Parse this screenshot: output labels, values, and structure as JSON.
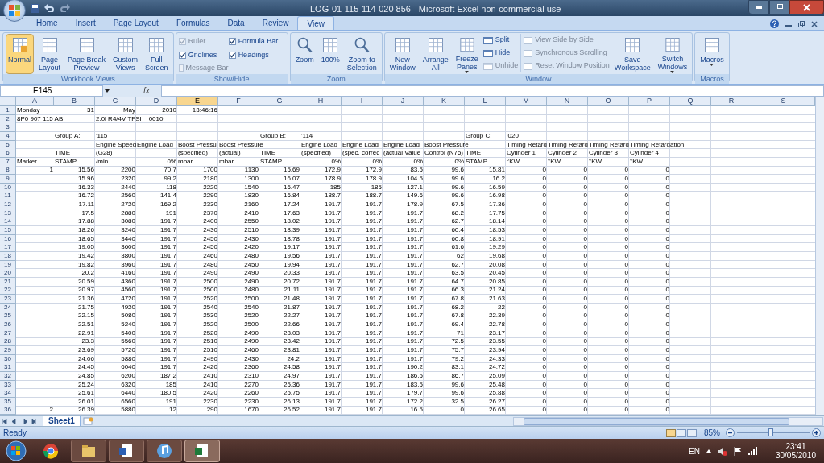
{
  "window": {
    "title": "LOG-01-115-114-020 856 - Microsoft Excel non-commercial use"
  },
  "tabs": [
    {
      "label": "Home",
      "selected": false
    },
    {
      "label": "Insert",
      "selected": false
    },
    {
      "label": "Page Layout",
      "selected": false
    },
    {
      "label": "Formulas",
      "selected": false
    },
    {
      "label": "Data",
      "selected": false
    },
    {
      "label": "Review",
      "selected": false
    },
    {
      "label": "View",
      "selected": true
    }
  ],
  "ribbon": {
    "workbook_views": {
      "title": "Workbook Views",
      "buttons": [
        {
          "label": "Normal",
          "selected": true
        },
        {
          "label": "Page\nLayout",
          "selected": false
        },
        {
          "label": "Page Break\nPreview",
          "selected": false
        },
        {
          "label": "Custom\nViews",
          "selected": false
        },
        {
          "label": "Full\nScreen",
          "selected": false
        }
      ]
    },
    "show_hide": {
      "title": "Show/Hide",
      "checkboxes": [
        {
          "label": "Ruler",
          "checked": true,
          "disabled": true
        },
        {
          "label": "Formula Bar",
          "checked": true,
          "disabled": false
        },
        {
          "label": "Gridlines",
          "checked": true,
          "disabled": false
        },
        {
          "label": "Headings",
          "checked": true,
          "disabled": false
        },
        {
          "label": "Message Bar",
          "checked": false,
          "disabled": true
        }
      ]
    },
    "zoom": {
      "title": "Zoom",
      "buttons": [
        {
          "label": "Zoom",
          "kind": "magnifier"
        },
        {
          "label": "100%",
          "kind": "page"
        },
        {
          "label": "Zoom to\nSelection",
          "kind": "magnifier"
        }
      ]
    },
    "window": {
      "title": "Window",
      "large": [
        {
          "label": "New\nWindow",
          "dropdown": false
        },
        {
          "label": "Arrange\nAll",
          "dropdown": false
        },
        {
          "label": "Freeze\nPanes",
          "dropdown": true
        }
      ],
      "small": [
        {
          "label": "Split",
          "disabled": false
        },
        {
          "label": "Hide",
          "disabled": false
        },
        {
          "label": "Unhide",
          "disabled": true
        },
        {
          "label": "View Side by Side",
          "disabled": true
        },
        {
          "label": "Synchronous Scrolling",
          "disabled": true
        },
        {
          "label": "Reset Window Position",
          "disabled": true
        }
      ],
      "large_right": [
        {
          "label": "Save\nWorkspace",
          "dropdown": false
        },
        {
          "label": "Switch\nWindows",
          "dropdown": true
        }
      ]
    },
    "macros": {
      "title": "Macros",
      "button": {
        "label": "Macros",
        "dropdown": true
      }
    }
  },
  "formula_bar": {
    "name_box": "E145",
    "fx": "fx"
  },
  "sheet": {
    "columns": [
      {
        "label": "A",
        "selected": false
      },
      {
        "label": "B",
        "selected": false
      },
      {
        "label": "C",
        "selected": false
      },
      {
        "label": "D",
        "selected": false
      },
      {
        "label": "E",
        "selected": true
      },
      {
        "label": "F",
        "selected": false
      },
      {
        "label": "G",
        "selected": false
      },
      {
        "label": "H",
        "selected": false
      },
      {
        "label": "I",
        "selected": false
      },
      {
        "label": "J",
        "selected": false
      },
      {
        "label": "K",
        "selected": false
      },
      {
        "label": "L",
        "selected": false
      },
      {
        "label": "M",
        "selected": false
      },
      {
        "label": "N",
        "selected": false
      },
      {
        "label": "O",
        "selected": false
      },
      {
        "label": "P",
        "selected": false
      },
      {
        "label": "Q",
        "selected": false
      },
      {
        "label": "R",
        "selected": false
      },
      {
        "label": "S",
        "selected": false
      }
    ],
    "rows": [
      {
        "label": "1",
        "kind": "header",
        "cells": {
          "A": {
            "text": "Monday",
            "kind": "text"
          },
          "B": {
            "text": "31",
            "kind": "number"
          },
          "C": {
            "text": "May",
            "kind": "number"
          },
          "D": {
            "text": "2010",
            "kind": "number"
          },
          "E": {
            "text": "13:46:16",
            "kind": "number"
          }
        }
      },
      {
        "label": "2",
        "kind": "header",
        "cells": {
          "A": {
            "text": "8P0 907 115 AB",
            "kind": "text"
          },
          "C": {
            "text": "2.0l R4/4V TFSI    0010",
            "kind": "text"
          }
        }
      },
      {
        "label": "3",
        "kind": "header"
      },
      {
        "label": "4",
        "kind": "header",
        "cells": {
          "B": {
            "text": "Group A:",
            "kind": "text"
          },
          "C": {
            "text": "'115",
            "kind": "text"
          },
          "G": {
            "text": "Group B:",
            "kind": "text"
          },
          "H": {
            "text": "'114",
            "kind": "text"
          },
          "L": {
            "text": "Group C:",
            "kind": "text"
          },
          "M": {
            "text": "'020",
            "kind": "text"
          }
        }
      },
      {
        "label": "5",
        "kind": "header",
        "cells": {
          "C": {
            "text": "Engine Speed",
            "kind": "text"
          },
          "D": {
            "text": "Engine Load",
            "kind": "text"
          },
          "E": {
            "text": "Boost Pressu",
            "kind": "text"
          },
          "F": {
            "text": "Boost Pressure",
            "kind": "text"
          },
          "H": {
            "text": "Engine Load",
            "kind": "text"
          },
          "I": {
            "text": "Engine Load",
            "kind": "text"
          },
          "J": {
            "text": "Engine Load",
            "kind": "text"
          },
          "K": {
            "text": "Boost Pressure",
            "kind": "text"
          },
          "M": {
            "text": "Timing Retard",
            "kind": "text"
          },
          "N": {
            "text": "Timing Retard",
            "kind": "text"
          },
          "O": {
            "text": "Timing Retard",
            "kind": "text"
          },
          "P": {
            "text": "Timing Retardation",
            "kind": "text"
          }
        }
      },
      {
        "label": "6",
        "kind": "header",
        "cells": {
          "B": {
            "text": "TIME",
            "kind": "text"
          },
          "C": {
            "text": "(G28)",
            "kind": "text"
          },
          "E": {
            "text": "(specified)",
            "kind": "text"
          },
          "F": {
            "text": "(actual)",
            "kind": "text"
          },
          "G": {
            "text": "TIME",
            "kind": "text"
          },
          "H": {
            "text": "(specified)",
            "kind": "text"
          },
          "I": {
            "text": "(spec. correc",
            "kind": "text"
          },
          "J": {
            "text": "(actual Value",
            "kind": "text"
          },
          "K": {
            "text": "Control (N75)",
            "kind": "text"
          },
          "L": {
            "text": "TIME",
            "kind": "text"
          },
          "M": {
            "text": "Cylinder 1",
            "kind": "text"
          },
          "N": {
            "text": "Cylinder 2",
            "kind": "text"
          },
          "O": {
            "text": "Cylinder 3",
            "kind": "text"
          },
          "P": {
            "text": "Cylinder 4",
            "kind": "text"
          }
        }
      },
      {
        "label": "7",
        "kind": "header",
        "cells": {
          "A": {
            "text": "Marker",
            "kind": "text"
          },
          "B": {
            "text": "STAMP",
            "kind": "text"
          },
          "C": {
            "text": "/min",
            "kind": "text"
          },
          "D": {
            "text": "0%",
            "kind": "number"
          },
          "E": {
            "text": "mbar",
            "kind": "text"
          },
          "F": {
            "text": "mbar",
            "kind": "text"
          },
          "G": {
            "text": "STAMP",
            "kind": "text"
          },
          "H": {
            "text": "0%",
            "kind": "number"
          },
          "I": {
            "text": "0%",
            "kind": "number"
          },
          "J": {
            "text": "0%",
            "kind": "number"
          },
          "K": {
            "text": "0%",
            "kind": "number"
          },
          "L": {
            "text": "STAMP",
            "kind": "text"
          },
          "M": {
            "text": "°KW",
            "kind": "text"
          },
          "N": {
            "text": "°KW",
            "kind": "text"
          },
          "O": {
            "text": "°KW",
            "kind": "text"
          },
          "P": {
            "text": "°KW",
            "kind": "text"
          }
        }
      },
      {
        "label": "8",
        "kind": "data",
        "marker": "1",
        "values": [
          "15.56",
          "2200",
          "70.7",
          "1700",
          "1130",
          "15.69",
          "172.9",
          "172.9",
          "83.5",
          "99.6",
          "15.81",
          "0",
          "0",
          "0",
          "0"
        ]
      },
      {
        "label": "9",
        "kind": "data",
        "values": [
          "15.96",
          "2320",
          "99.2",
          "2180",
          "1300",
          "16.07",
          "178.9",
          "178.9",
          "104.5",
          "99.6",
          "16.2",
          "0",
          "0",
          "0",
          "0"
        ]
      },
      {
        "label": "10",
        "kind": "data",
        "values": [
          "16.33",
          "2440",
          "118",
          "2220",
          "1540",
          "16.47",
          "185",
          "185",
          "127.1",
          "99.6",
          "16.59",
          "0",
          "0",
          "0",
          "0"
        ]
      },
      {
        "label": "11",
        "kind": "data",
        "values": [
          "16.72",
          "2560",
          "141.4",
          "2290",
          "1830",
          "16.84",
          "188.7",
          "188.7",
          "149.6",
          "99.6",
          "16.98",
          "0",
          "0",
          "0",
          "0"
        ]
      },
      {
        "label": "12",
        "kind": "data",
        "values": [
          "17.11",
          "2720",
          "169.2",
          "2330",
          "2160",
          "17.24",
          "191.7",
          "191.7",
          "178.9",
          "67.5",
          "17.36",
          "0",
          "0",
          "0",
          "0"
        ]
      },
      {
        "label": "13",
        "kind": "data",
        "values": [
          "17.5",
          "2880",
          "191",
          "2370",
          "2410",
          "17.63",
          "191.7",
          "191.7",
          "191.7",
          "68.2",
          "17.75",
          "0",
          "0",
          "0",
          "0"
        ]
      },
      {
        "label": "14",
        "kind": "data",
        "values": [
          "17.88",
          "3080",
          "191.7",
          "2400",
          "2550",
          "18.02",
          "191.7",
          "191.7",
          "191.7",
          "62.7",
          "18.14",
          "0",
          "0",
          "0",
          "0"
        ]
      },
      {
        "label": "15",
        "kind": "data",
        "values": [
          "18.26",
          "3240",
          "191.7",
          "2430",
          "2510",
          "18.39",
          "191.7",
          "191.7",
          "191.7",
          "60.4",
          "18.53",
          "0",
          "0",
          "0",
          "0"
        ]
      },
      {
        "label": "16",
        "kind": "data",
        "values": [
          "18.65",
          "3440",
          "191.7",
          "2450",
          "2430",
          "18.78",
          "191.7",
          "191.7",
          "191.7",
          "60.8",
          "18.91",
          "0",
          "0",
          "0",
          "0"
        ]
      },
      {
        "label": "17",
        "kind": "data",
        "values": [
          "19.05",
          "3600",
          "191.7",
          "2450",
          "2420",
          "19.17",
          "191.7",
          "191.7",
          "191.7",
          "61.6",
          "19.29",
          "0",
          "0",
          "0",
          "0"
        ]
      },
      {
        "label": "18",
        "kind": "data",
        "values": [
          "19.42",
          "3800",
          "191.7",
          "2460",
          "2480",
          "19.56",
          "191.7",
          "191.7",
          "191.7",
          "62",
          "19.68",
          "0",
          "0",
          "0",
          "0"
        ]
      },
      {
        "label": "19",
        "kind": "data",
        "values": [
          "19.82",
          "3960",
          "191.7",
          "2480",
          "2450",
          "19.94",
          "191.7",
          "191.7",
          "191.7",
          "62.7",
          "20.08",
          "0",
          "0",
          "0",
          "0"
        ]
      },
      {
        "label": "20",
        "kind": "data",
        "values": [
          "20.2",
          "4160",
          "191.7",
          "2490",
          "2490",
          "20.33",
          "191.7",
          "191.7",
          "191.7",
          "63.5",
          "20.45",
          "0",
          "0",
          "0",
          "0"
        ]
      },
      {
        "label": "21",
        "kind": "data",
        "values": [
          "20.59",
          "4360",
          "191.7",
          "2500",
          "2490",
          "20.72",
          "191.7",
          "191.7",
          "191.7",
          "64.7",
          "20.85",
          "0",
          "0",
          "0",
          "0"
        ]
      },
      {
        "label": "22",
        "kind": "data",
        "values": [
          "20.97",
          "4560",
          "191.7",
          "2500",
          "2480",
          "21.11",
          "191.7",
          "191.7",
          "191.7",
          "66.3",
          "21.24",
          "0",
          "0",
          "0",
          "0"
        ]
      },
      {
        "label": "23",
        "kind": "data",
        "values": [
          "21.36",
          "4720",
          "191.7",
          "2520",
          "2500",
          "21.48",
          "191.7",
          "191.7",
          "191.7",
          "67.8",
          "21.63",
          "0",
          "0",
          "0",
          "0"
        ]
      },
      {
        "label": "24",
        "kind": "data",
        "values": [
          "21.75",
          "4920",
          "191.7",
          "2540",
          "2540",
          "21.87",
          "191.7",
          "191.7",
          "191.7",
          "68.2",
          "22",
          "0",
          "0",
          "0",
          "0"
        ]
      },
      {
        "label": "25",
        "kind": "data",
        "values": [
          "22.15",
          "5080",
          "191.7",
          "2530",
          "2520",
          "22.27",
          "191.7",
          "191.7",
          "191.7",
          "67.8",
          "22.39",
          "0",
          "0",
          "0",
          "0"
        ]
      },
      {
        "label": "26",
        "kind": "data",
        "values": [
          "22.51",
          "5240",
          "191.7",
          "2520",
          "2500",
          "22.66",
          "191.7",
          "191.7",
          "191.7",
          "69.4",
          "22.78",
          "0",
          "0",
          "0",
          "0"
        ]
      },
      {
        "label": "27",
        "kind": "data",
        "values": [
          "22.91",
          "5400",
          "191.7",
          "2520",
          "2490",
          "23.03",
          "191.7",
          "191.7",
          "191.7",
          "71",
          "23.17",
          "0",
          "0",
          "0",
          "0"
        ]
      },
      {
        "label": "28",
        "kind": "data",
        "values": [
          "23.3",
          "5560",
          "191.7",
          "2510",
          "2490",
          "23.42",
          "191.7",
          "191.7",
          "191.7",
          "72.5",
          "23.55",
          "0",
          "0",
          "0",
          "0"
        ]
      },
      {
        "label": "29",
        "kind": "data",
        "values": [
          "23.69",
          "5720",
          "191.7",
          "2510",
          "2460",
          "23.81",
          "191.7",
          "191.7",
          "191.7",
          "75.7",
          "23.94",
          "0",
          "0",
          "0",
          "0"
        ]
      },
      {
        "label": "30",
        "kind": "data",
        "values": [
          "24.06",
          "5880",
          "191.7",
          "2490",
          "2430",
          "24.2",
          "191.7",
          "191.7",
          "191.7",
          "79.2",
          "24.33",
          "0",
          "0",
          "0",
          "0"
        ]
      },
      {
        "label": "31",
        "kind": "data",
        "values": [
          "24.45",
          "6040",
          "191.7",
          "2420",
          "2360",
          "24.58",
          "191.7",
          "191.7",
          "190.2",
          "83.1",
          "24.72",
          "0",
          "0",
          "0",
          "0"
        ]
      },
      {
        "label": "32",
        "kind": "data",
        "values": [
          "24.85",
          "6200",
          "187.2",
          "2410",
          "2310",
          "24.97",
          "191.7",
          "191.7",
          "186.5",
          "86.7",
          "25.09",
          "0",
          "0",
          "0",
          "0"
        ]
      },
      {
        "label": "33",
        "kind": "data",
        "values": [
          "25.24",
          "6320",
          "185",
          "2410",
          "2270",
          "25.36",
          "191.7",
          "191.7",
          "183.5",
          "99.6",
          "25.48",
          "0",
          "0",
          "0",
          "0"
        ]
      },
      {
        "label": "34",
        "kind": "data",
        "values": [
          "25.61",
          "6440",
          "180.5",
          "2420",
          "2260",
          "25.75",
          "191.7",
          "191.7",
          "179.7",
          "99.6",
          "25.88",
          "0",
          "0",
          "0",
          "0"
        ]
      },
      {
        "label": "35",
        "kind": "data",
        "values": [
          "26.01",
          "6560",
          "191",
          "2230",
          "2230",
          "26.13",
          "191.7",
          "191.7",
          "172.2",
          "32.5",
          "26.27",
          "0",
          "0",
          "0",
          "0"
        ]
      },
      {
        "label": "36",
        "kind": "data",
        "marker": "2",
        "values": [
          "26.39",
          "5880",
          "12",
          "290",
          "1670",
          "26.52",
          "191.7",
          "191.7",
          "16.5",
          "0",
          "26.65",
          "0",
          "0",
          "0",
          "0"
        ]
      }
    ]
  },
  "sheet_tabs": [
    {
      "label": "Sheet1",
      "selected": true
    }
  ],
  "status_bar": {
    "status": "Ready",
    "zoom": "85%",
    "zoom_slider": {
      "level": 0.47
    }
  },
  "taskbar": {
    "language": "EN",
    "time": "23:41",
    "date": "30/05/2010"
  }
}
